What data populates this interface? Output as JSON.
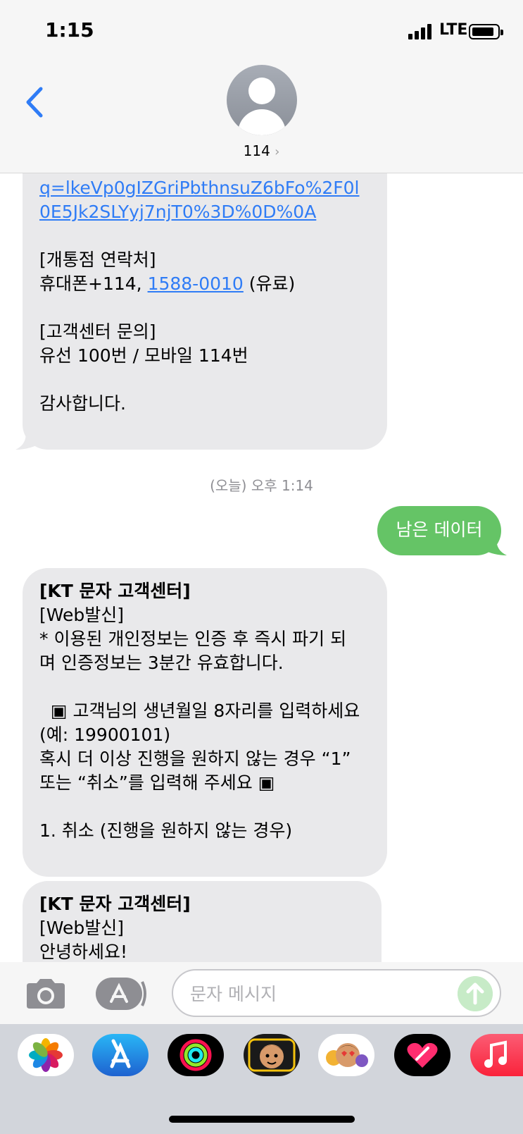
{
  "status_bar": {
    "time": "1:15",
    "network": "LTE"
  },
  "header": {
    "contact_name": "114",
    "chevron": "›"
  },
  "messages": {
    "first": {
      "lines": [
        "q=lkeVp0gIZGriPbthnsuZ6bFo%2F0l",
        "0E5Jk2SLYyj7njT0%3D%0D%0A",
        "",
        "[개통점 연락처]",
        "휴대폰+114, ",
        "",
        "[고객센터 문의]",
        "유선 100번 / 모바일 114번",
        "",
        "감사합니다."
      ],
      "phone_link": "1588-0010",
      "phone_suffix": " (유료)"
    },
    "timestamp": "(오늘) 오후 1:14",
    "outgoing": "남은 데이터",
    "second": {
      "title": "[KT 문자 고객센터]",
      "lines": [
        "[Web발신]",
        "* 이용된 개인정보는 인증 후 즉시 파기 되",
        "며 인증정보는 3분간 유효합니다.",
        "",
        "  ▣ 고객님의 생년월일 8자리를 입력하세요",
        "(예: 19900101)",
        "혹시 더 이상 진행을 원하지 않는 경우 “1”",
        "또는 “취소”를 입력해 주세요 ▣",
        "",
        "1. 취소 (진행을 원하지 않는 경우)"
      ]
    },
    "third": {
      "title": "[KT 문자 고객센터]",
      "lines": [
        "[Web발신]",
        "안녕하세요!"
      ]
    }
  },
  "input_bar": {
    "placeholder": "문자 메시지"
  },
  "dock": {
    "apps": [
      "photos-app-icon",
      "app-store-app-icon",
      "fitness-app-icon",
      "memoji-app-icon",
      "animoji-app-icon",
      "digital-touch-app-icon",
      "music-app-icon"
    ]
  },
  "colors": {
    "link": "#2f7cf6",
    "outgoing_bubble": "#65c466",
    "incoming_bubble": "#e9e9eb",
    "back_chevron": "#2f7cf6"
  }
}
